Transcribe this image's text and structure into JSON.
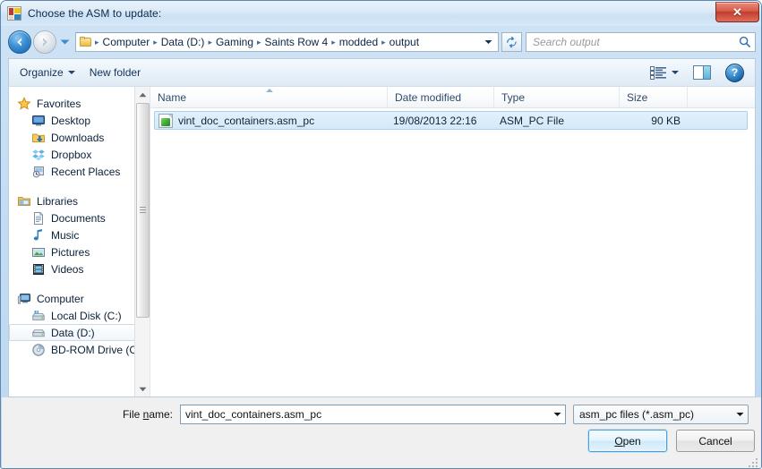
{
  "window": {
    "title": "Choose the ASM to update:",
    "app_icon": "app-window-icon",
    "close_label": "✕"
  },
  "addressbar": {
    "back_tooltip": "Back",
    "forward_tooltip": "Forward",
    "crumbs": [
      "Computer",
      "Data (D:)",
      "Gaming",
      "Saints Row 4",
      "modded",
      "output"
    ],
    "separator": "▸",
    "refresh_icon": "refresh-icon",
    "search_placeholder": "Search output",
    "search_icon": "search-icon"
  },
  "toolbar": {
    "organize_label": "Organize",
    "new_folder_label": "New folder",
    "view_icon": "view-list-icon",
    "preview_pane_icon": "preview-pane-icon",
    "help_icon": "help-icon",
    "help_glyph": "?"
  },
  "sidebar": {
    "groups": [
      {
        "name": "Favorites",
        "icon": "star-icon",
        "items": [
          {
            "label": "Desktop",
            "icon": "desktop-icon"
          },
          {
            "label": "Downloads",
            "icon": "downloads-icon"
          },
          {
            "label": "Dropbox",
            "icon": "dropbox-icon"
          },
          {
            "label": "Recent Places",
            "icon": "recent-places-icon"
          }
        ]
      },
      {
        "name": "Libraries",
        "icon": "libraries-icon",
        "items": [
          {
            "label": "Documents",
            "icon": "document-icon"
          },
          {
            "label": "Music",
            "icon": "music-note-icon"
          },
          {
            "label": "Pictures",
            "icon": "picture-icon"
          },
          {
            "label": "Videos",
            "icon": "video-film-icon"
          }
        ]
      },
      {
        "name": "Computer",
        "icon": "computer-icon",
        "items": [
          {
            "label": "Local Disk (C:)",
            "icon": "hard-drive-system-icon"
          },
          {
            "label": "Data (D:)",
            "icon": "hard-drive-icon",
            "selected": true
          },
          {
            "label": "BD-ROM Drive (C",
            "icon": "optical-drive-icon"
          }
        ]
      }
    ]
  },
  "filelist": {
    "columns": [
      "Name",
      "Date modified",
      "Type",
      "Size"
    ],
    "sort_column": "Name",
    "sort_direction": "ascending",
    "rows": [
      {
        "name": "vint_doc_containers.asm_pc",
        "date_modified": "19/08/2013 22:16",
        "type": "ASM_PC File",
        "size": "90 KB",
        "icon": "asm-pc-file-icon",
        "selected": true
      }
    ]
  },
  "footer": {
    "filename_label_pre": "File ",
    "filename_label_accel": "n",
    "filename_label_post": "ame:",
    "filename_value": "vint_doc_containers.asm_pc",
    "filter_value": "asm_pc files (*.asm_pc)",
    "open_accel": "O",
    "open_rest": "pen",
    "cancel_label": "Cancel"
  },
  "colors": {
    "title_bar": "#d6e8f8",
    "dialog_border": "#5c87b2",
    "close_button": "#c23d2b",
    "selection": "#d4e9f9",
    "selection_border": "#a6d0ee",
    "footer_bg": "#f0f0f0",
    "accent_blue": "#1760a8"
  }
}
